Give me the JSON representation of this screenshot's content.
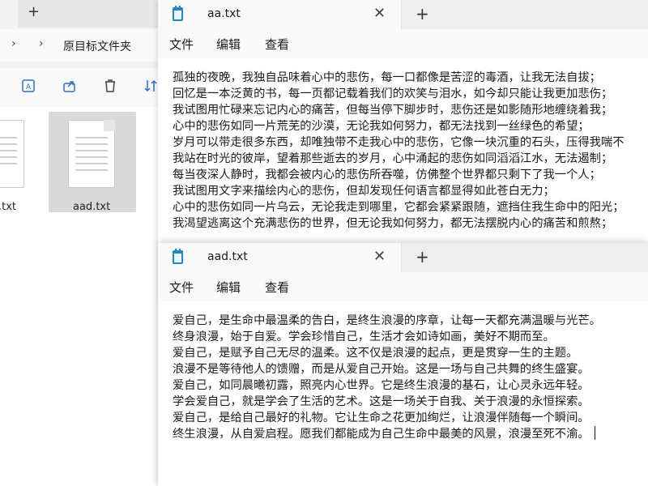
{
  "explorer": {
    "new_tab_glyph": "+",
    "breadcrumb": "原目标文件夹",
    "files": [
      {
        "name": "a.txt",
        "selected": false
      },
      {
        "name": "aad.txt",
        "selected": true
      }
    ]
  },
  "notepad_aa": {
    "tab_title": "aa.txt",
    "close_glyph": "✕",
    "new_tab_glyph": "+",
    "menu": {
      "file": "文件",
      "edit": "编辑",
      "view": "查看"
    },
    "lines": [
      "孤独的夜晚，我独自品味着心中的悲伤，每一口都像是苦涩的毒酒，让我无法自拔；",
      "回忆是一本泛黄的书，每一页都记载着我们的欢笑与泪水，如今却只能让我更加悲伤；",
      "我试图用忙碌来忘记内心的痛苦，但每当停下脚步时，悲伤还是如影随形地缠绕着我；",
      "心中的悲伤如同一片荒芜的沙漠，无论我如何努力，都无法找到一丝绿色的希望；",
      "岁月可以带走很多东西，却唯独带不走我心中的悲伤，它像一块沉重的石头，压得我喘不",
      "我站在时光的彼岸，望着那些逝去的岁月，心中涌起的悲伤如同滔滔江水，无法遏制；",
      "每当夜深人静时，我都会被内心的悲伤所吞噬，仿佛整个世界都只剩下了我一个人；",
      "我试图用文字来描绘内心的悲伤，但却发现任何语言都显得如此苍白无力；",
      "心中的悲伤如同一片乌云，无论我走到哪里，它都会紧紧跟随，遮挡住我生命中的阳光；",
      "我渴望逃离这个充满悲伤的世界，但无论我如何努力，都无法摆脱内心的痛苦和煎熬；"
    ]
  },
  "notepad_aad": {
    "tab_title": "aad.txt",
    "close_glyph": "✕",
    "new_tab_glyph": "+",
    "menu": {
      "file": "文件",
      "edit": "编辑",
      "view": "查看"
    },
    "lines": [
      "爱自己，是生命中最温柔的告白，是终生浪漫的序章，让每一天都充满温暖与光芒。",
      "终身浪漫，始于自爱。学会珍惜自己，生活才会如诗如画，美好不期而至。",
      "爱自己，是赋予自己无尽的温柔。这不仅是浪漫的起点，更是贯穿一生的主题。",
      "浪漫不是等待他人的馈赠，而是从爱自己开始。这是一场与自己共舞的终生盛宴。",
      "爱自己，如同晨曦初露，照亮内心世界。它是终生浪漫的基石，让心灵永远年轻。",
      "学会爱自己，就是学会了生活的艺术。这是一场关于自我、关于浪漫的永恒探索。",
      "爱自己，是给自己最好的礼物。它让生命之花更加绚烂，让浪漫伴随每一个瞬间。",
      "终生浪漫，从自爱启程。愿我们都能成为自己生命中最美的风景，浪漫至死不渝。"
    ]
  }
}
